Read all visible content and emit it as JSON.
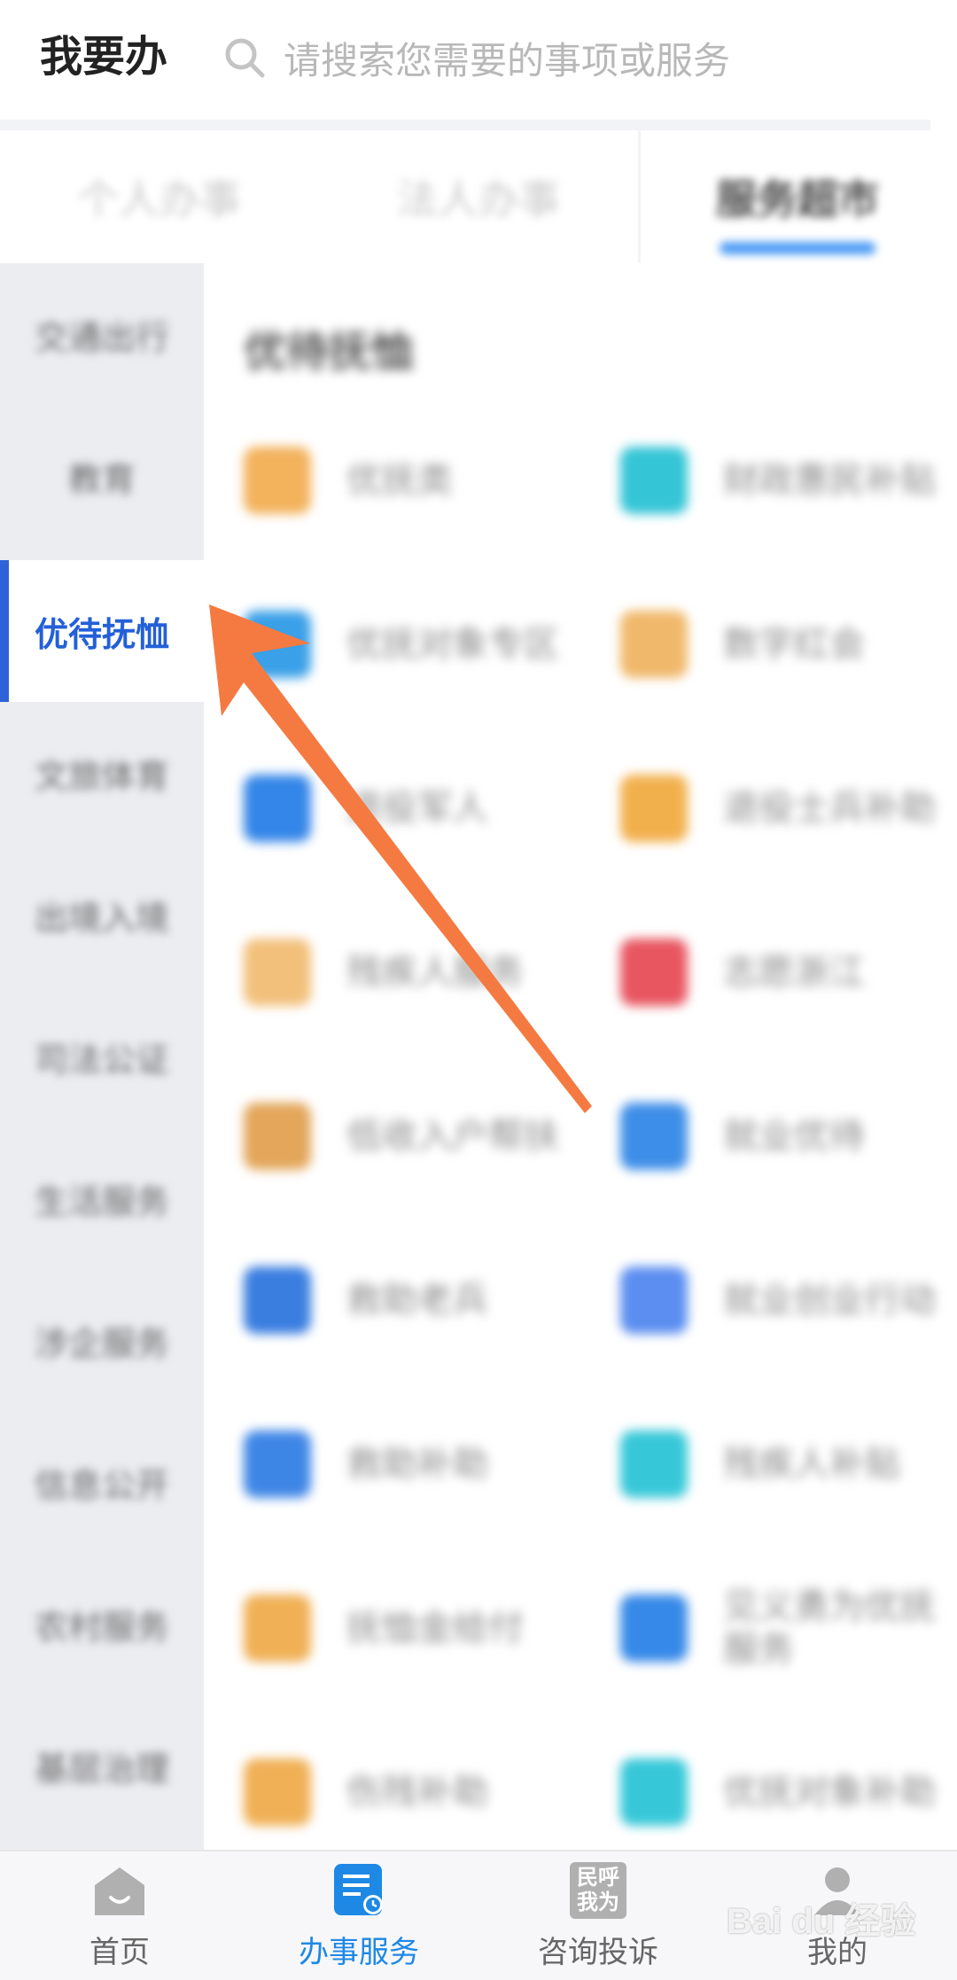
{
  "header": {
    "title": "我要办",
    "search_placeholder": "请搜索您需要的事项或服务"
  },
  "tabs": [
    {
      "label": "个人办事",
      "active": false
    },
    {
      "label": "法人办事",
      "active": false
    },
    {
      "label": "服务超市",
      "active": true
    }
  ],
  "sidebar": {
    "items": [
      {
        "label": "交通出行",
        "selected": false
      },
      {
        "label": "教育",
        "selected": false
      },
      {
        "label": "优待抚恤",
        "selected": true
      },
      {
        "label": "文旅体育",
        "selected": false
      },
      {
        "label": "出境入境",
        "selected": false
      },
      {
        "label": "司法公证",
        "selected": false
      },
      {
        "label": "生活服务",
        "selected": false
      },
      {
        "label": "涉企服务",
        "selected": false
      },
      {
        "label": "信息公开",
        "selected": false
      },
      {
        "label": "农村服务",
        "selected": false
      },
      {
        "label": "基层治理",
        "selected": false
      }
    ]
  },
  "content": {
    "section_title": "优待抚恤",
    "items": [
      {
        "label": "优抚类",
        "color": "#f3b25c"
      },
      {
        "label": "财政惠民补贴",
        "color": "#34c5d6"
      },
      {
        "label": "优抚对象专区",
        "color": "#3aa0e8"
      },
      {
        "label": "数字红会",
        "color": "#f0b86a"
      },
      {
        "label": "退役军人",
        "color": "#3486e8"
      },
      {
        "label": "退役士兵补助",
        "color": "#f2b04c"
      },
      {
        "label": "残疾人服务",
        "color": "#f2c07a"
      },
      {
        "label": "志愿浙江",
        "color": "#e85660"
      },
      {
        "label": "低收入户帮扶",
        "color": "#e3a65a"
      },
      {
        "label": "就业优待",
        "color": "#3d8ee8"
      },
      {
        "label": "救助老兵",
        "color": "#3a7ee0"
      },
      {
        "label": "就业创业行动",
        "color": "#5b8ef0"
      },
      {
        "label": "救助补助",
        "color": "#3e86e6"
      },
      {
        "label": "残疾人补贴",
        "color": "#36c8d8"
      },
      {
        "label": "抚恤金给付",
        "color": "#f0b055"
      },
      {
        "label": "见义勇为优抚服务",
        "color": "#3689e8"
      },
      {
        "label": "伤残补助",
        "color": "#f0b055"
      },
      {
        "label": "优抚对象补助",
        "color": "#36c8d8"
      }
    ]
  },
  "bottom_nav": [
    {
      "label": "首页",
      "active": false,
      "icon": "home-icon"
    },
    {
      "label": "办事服务",
      "active": true,
      "icon": "service-doc-icon"
    },
    {
      "label": "咨询投诉",
      "active": false,
      "icon": "minhu-woweiicon",
      "icon_text": "民呼我为"
    },
    {
      "label": "我的",
      "active": false,
      "icon": "user-icon"
    }
  ],
  "watermark": "Bai du 经验",
  "colors": {
    "accent": "#2360d8",
    "nav_active": "#1e88e5",
    "arrow": "#f47a42"
  }
}
